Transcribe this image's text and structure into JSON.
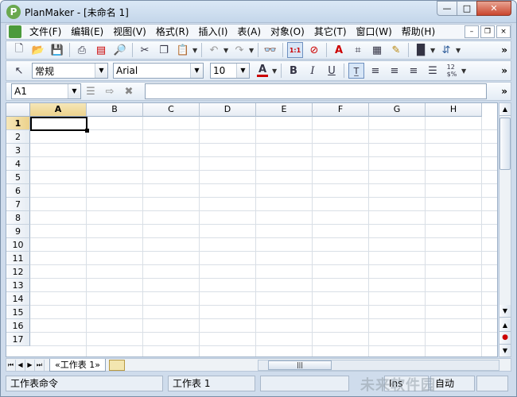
{
  "window": {
    "app_name": "PlanMaker",
    "title": "PlanMaker - [未命名 1]",
    "buttons": {
      "minimize": "—",
      "maximize": "□",
      "close": "✕"
    }
  },
  "menubar": {
    "items": [
      "文件(F)",
      "编辑(E)",
      "视图(V)",
      "格式(R)",
      "插入(I)",
      "表(A)",
      "对象(O)",
      "其它(T)",
      "窗口(W)",
      "帮助(H)"
    ],
    "mdi": {
      "minimize": "–",
      "restore": "❐",
      "close": "×"
    }
  },
  "toolbar_standard": {
    "icons": [
      "new-icon",
      "open-icon",
      "save-icon",
      "print-icon",
      "pdf-export-icon",
      "print-preview-icon",
      "cut-icon",
      "copy-icon",
      "paste-icon",
      "undo-icon",
      "redo-icon",
      "find-icon",
      "zoom-actual-icon",
      "zoom-icon",
      "textframe-icon",
      "table-icon",
      "grid-icon",
      "format-painter-icon",
      "chart-icon",
      "sort-icon"
    ],
    "more": "»"
  },
  "toolbar_format": {
    "style": "常规",
    "font": "Arial",
    "size": "10",
    "font_color_label": "A",
    "font_color": "#cc0000",
    "bold": "B",
    "italic": "I",
    "underline": "U",
    "more": "»"
  },
  "formula_bar": {
    "cell_ref": "A1",
    "value": "",
    "more": "»"
  },
  "sheet": {
    "columns": [
      "A",
      "B",
      "C",
      "D",
      "E",
      "F",
      "G",
      "H"
    ],
    "rows": [
      "1",
      "2",
      "3",
      "4",
      "5",
      "6",
      "7",
      "8",
      "9",
      "10",
      "11",
      "12",
      "13",
      "14",
      "15",
      "16",
      "17"
    ],
    "active_cell": "A1"
  },
  "tabs": {
    "sheets": [
      "«工作表 1»"
    ],
    "nav": [
      "⏮",
      "◀",
      "▶",
      "⏭"
    ]
  },
  "statusbar": {
    "command": "工作表命令",
    "sheet_name": "工作表 1",
    "mode": "Ins",
    "calc": "自动"
  },
  "watermark": "未来软件园"
}
